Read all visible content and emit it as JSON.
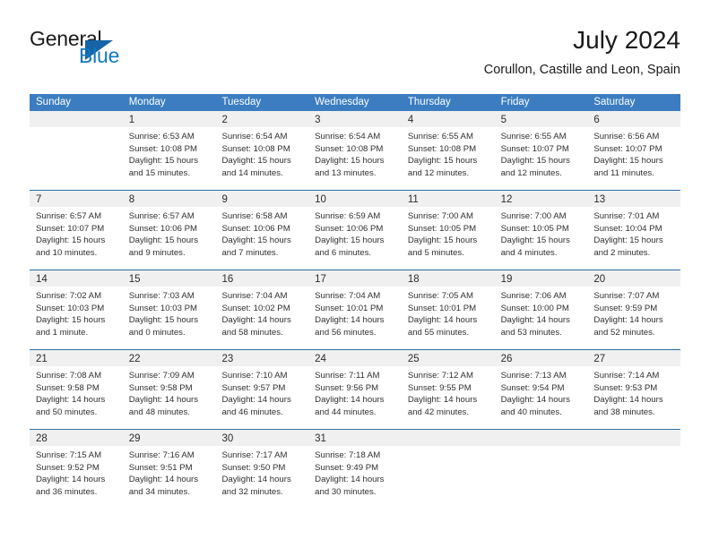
{
  "brand": {
    "name_part1": "General",
    "name_part2": "Blue",
    "triangle_icon": "triangle-logo-icon",
    "accent_dark": "#1763a6",
    "accent_blue": "#1278be"
  },
  "header": {
    "title": "July 2024",
    "subtitle": "Corullon, Castille and Leon, Spain",
    "header_bg": "#3b7dc0",
    "separator_color": "#2e6da8",
    "day_band_bg": "#f0f0f0"
  },
  "weekday_headers": [
    "Sunday",
    "Monday",
    "Tuesday",
    "Wednesday",
    "Thursday",
    "Friday",
    "Saturday"
  ],
  "weeks": [
    [
      {
        "day": "",
        "sunrise": "",
        "sunset": "",
        "daylight1": "",
        "daylight2": ""
      },
      {
        "day": "1",
        "sunrise": "Sunrise: 6:53 AM",
        "sunset": "Sunset: 10:08 PM",
        "daylight1": "Daylight: 15 hours",
        "daylight2": "and 15 minutes."
      },
      {
        "day": "2",
        "sunrise": "Sunrise: 6:54 AM",
        "sunset": "Sunset: 10:08 PM",
        "daylight1": "Daylight: 15 hours",
        "daylight2": "and 14 minutes."
      },
      {
        "day": "3",
        "sunrise": "Sunrise: 6:54 AM",
        "sunset": "Sunset: 10:08 PM",
        "daylight1": "Daylight: 15 hours",
        "daylight2": "and 13 minutes."
      },
      {
        "day": "4",
        "sunrise": "Sunrise: 6:55 AM",
        "sunset": "Sunset: 10:08 PM",
        "daylight1": "Daylight: 15 hours",
        "daylight2": "and 12 minutes."
      },
      {
        "day": "5",
        "sunrise": "Sunrise: 6:55 AM",
        "sunset": "Sunset: 10:07 PM",
        "daylight1": "Daylight: 15 hours",
        "daylight2": "and 12 minutes."
      },
      {
        "day": "6",
        "sunrise": "Sunrise: 6:56 AM",
        "sunset": "Sunset: 10:07 PM",
        "daylight1": "Daylight: 15 hours",
        "daylight2": "and 11 minutes."
      }
    ],
    [
      {
        "day": "7",
        "sunrise": "Sunrise: 6:57 AM",
        "sunset": "Sunset: 10:07 PM",
        "daylight1": "Daylight: 15 hours",
        "daylight2": "and 10 minutes."
      },
      {
        "day": "8",
        "sunrise": "Sunrise: 6:57 AM",
        "sunset": "Sunset: 10:06 PM",
        "daylight1": "Daylight: 15 hours",
        "daylight2": "and 9 minutes."
      },
      {
        "day": "9",
        "sunrise": "Sunrise: 6:58 AM",
        "sunset": "Sunset: 10:06 PM",
        "daylight1": "Daylight: 15 hours",
        "daylight2": "and 7 minutes."
      },
      {
        "day": "10",
        "sunrise": "Sunrise: 6:59 AM",
        "sunset": "Sunset: 10:06 PM",
        "daylight1": "Daylight: 15 hours",
        "daylight2": "and 6 minutes."
      },
      {
        "day": "11",
        "sunrise": "Sunrise: 7:00 AM",
        "sunset": "Sunset: 10:05 PM",
        "daylight1": "Daylight: 15 hours",
        "daylight2": "and 5 minutes."
      },
      {
        "day": "12",
        "sunrise": "Sunrise: 7:00 AM",
        "sunset": "Sunset: 10:05 PM",
        "daylight1": "Daylight: 15 hours",
        "daylight2": "and 4 minutes."
      },
      {
        "day": "13",
        "sunrise": "Sunrise: 7:01 AM",
        "sunset": "Sunset: 10:04 PM",
        "daylight1": "Daylight: 15 hours",
        "daylight2": "and 2 minutes."
      }
    ],
    [
      {
        "day": "14",
        "sunrise": "Sunrise: 7:02 AM",
        "sunset": "Sunset: 10:03 PM",
        "daylight1": "Daylight: 15 hours",
        "daylight2": "and 1 minute."
      },
      {
        "day": "15",
        "sunrise": "Sunrise: 7:03 AM",
        "sunset": "Sunset: 10:03 PM",
        "daylight1": "Daylight: 15 hours",
        "daylight2": "and 0 minutes."
      },
      {
        "day": "16",
        "sunrise": "Sunrise: 7:04 AM",
        "sunset": "Sunset: 10:02 PM",
        "daylight1": "Daylight: 14 hours",
        "daylight2": "and 58 minutes."
      },
      {
        "day": "17",
        "sunrise": "Sunrise: 7:04 AM",
        "sunset": "Sunset: 10:01 PM",
        "daylight1": "Daylight: 14 hours",
        "daylight2": "and 56 minutes."
      },
      {
        "day": "18",
        "sunrise": "Sunrise: 7:05 AM",
        "sunset": "Sunset: 10:01 PM",
        "daylight1": "Daylight: 14 hours",
        "daylight2": "and 55 minutes."
      },
      {
        "day": "19",
        "sunrise": "Sunrise: 7:06 AM",
        "sunset": "Sunset: 10:00 PM",
        "daylight1": "Daylight: 14 hours",
        "daylight2": "and 53 minutes."
      },
      {
        "day": "20",
        "sunrise": "Sunrise: 7:07 AM",
        "sunset": "Sunset: 9:59 PM",
        "daylight1": "Daylight: 14 hours",
        "daylight2": "and 52 minutes."
      }
    ],
    [
      {
        "day": "21",
        "sunrise": "Sunrise: 7:08 AM",
        "sunset": "Sunset: 9:58 PM",
        "daylight1": "Daylight: 14 hours",
        "daylight2": "and 50 minutes."
      },
      {
        "day": "22",
        "sunrise": "Sunrise: 7:09 AM",
        "sunset": "Sunset: 9:58 PM",
        "daylight1": "Daylight: 14 hours",
        "daylight2": "and 48 minutes."
      },
      {
        "day": "23",
        "sunrise": "Sunrise: 7:10 AM",
        "sunset": "Sunset: 9:57 PM",
        "daylight1": "Daylight: 14 hours",
        "daylight2": "and 46 minutes."
      },
      {
        "day": "24",
        "sunrise": "Sunrise: 7:11 AM",
        "sunset": "Sunset: 9:56 PM",
        "daylight1": "Daylight: 14 hours",
        "daylight2": "and 44 minutes."
      },
      {
        "day": "25",
        "sunrise": "Sunrise: 7:12 AM",
        "sunset": "Sunset: 9:55 PM",
        "daylight1": "Daylight: 14 hours",
        "daylight2": "and 42 minutes."
      },
      {
        "day": "26",
        "sunrise": "Sunrise: 7:13 AM",
        "sunset": "Sunset: 9:54 PM",
        "daylight1": "Daylight: 14 hours",
        "daylight2": "and 40 minutes."
      },
      {
        "day": "27",
        "sunrise": "Sunrise: 7:14 AM",
        "sunset": "Sunset: 9:53 PM",
        "daylight1": "Daylight: 14 hours",
        "daylight2": "and 38 minutes."
      }
    ],
    [
      {
        "day": "28",
        "sunrise": "Sunrise: 7:15 AM",
        "sunset": "Sunset: 9:52 PM",
        "daylight1": "Daylight: 14 hours",
        "daylight2": "and 36 minutes."
      },
      {
        "day": "29",
        "sunrise": "Sunrise: 7:16 AM",
        "sunset": "Sunset: 9:51 PM",
        "daylight1": "Daylight: 14 hours",
        "daylight2": "and 34 minutes."
      },
      {
        "day": "30",
        "sunrise": "Sunrise: 7:17 AM",
        "sunset": "Sunset: 9:50 PM",
        "daylight1": "Daylight: 14 hours",
        "daylight2": "and 32 minutes."
      },
      {
        "day": "31",
        "sunrise": "Sunrise: 7:18 AM",
        "sunset": "Sunset: 9:49 PM",
        "daylight1": "Daylight: 14 hours",
        "daylight2": "and 30 minutes."
      },
      {
        "day": "",
        "sunrise": "",
        "sunset": "",
        "daylight1": "",
        "daylight2": ""
      },
      {
        "day": "",
        "sunrise": "",
        "sunset": "",
        "daylight1": "",
        "daylight2": ""
      },
      {
        "day": "",
        "sunrise": "",
        "sunset": "",
        "daylight1": "",
        "daylight2": ""
      }
    ]
  ]
}
